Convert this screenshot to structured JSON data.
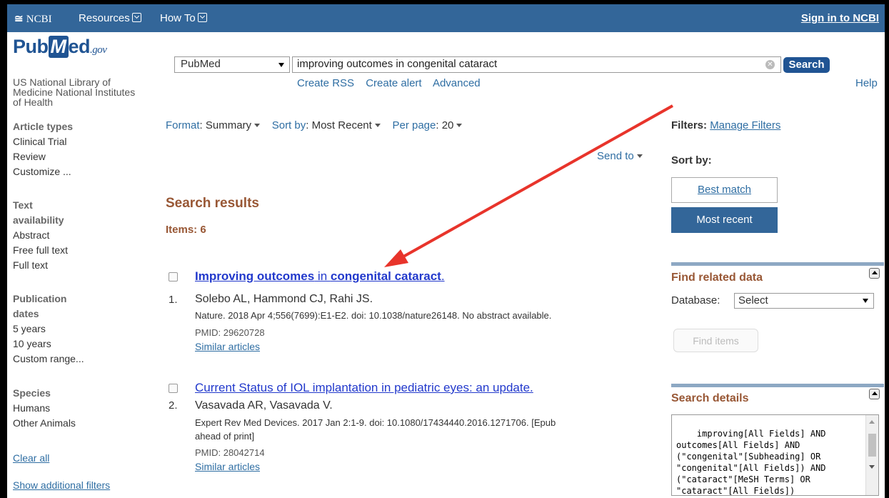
{
  "topbar": {
    "ncbi": "NCBI",
    "resources": "Resources",
    "howto": "How To",
    "signin": "Sign in to NCBI"
  },
  "header": {
    "logo_pub": "Pub",
    "logo_m": "M",
    "logo_ed": "ed",
    "logo_gov": ".gov",
    "logo_sub1": "US National Library of",
    "logo_sub2": "Medicine National Institutes",
    "logo_sub3": "of Health",
    "db_value": "PubMed",
    "search_value": "improving outcomes in congenital cataract",
    "search_button": "Search",
    "links": [
      "Create RSS",
      "Create alert",
      "Advanced"
    ],
    "help": "Help"
  },
  "sidebar": {
    "article_types": {
      "heading": "Article types",
      "items": [
        "Clinical Trial",
        "Review",
        "Customize ..."
      ]
    },
    "text_availability": {
      "heading1": "Text",
      "heading2": "availability",
      "items": [
        "Abstract",
        "Free full text",
        "Full text"
      ]
    },
    "pub_dates": {
      "heading1": "Publication",
      "heading2": "dates",
      "items": [
        "5 years",
        "10 years",
        "Custom range..."
      ]
    },
    "species": {
      "heading": "Species",
      "items": [
        "Humans",
        "Other Animals"
      ]
    },
    "clear_all": "Clear all",
    "show_filters": "Show additional filters"
  },
  "toolbar": {
    "format_label": "Format",
    "format_value": "Summary",
    "sort_label": "Sort by",
    "sort_value": "Most Recent",
    "perpage_label": "Per page",
    "perpage_value": "20",
    "send_to": "Send to"
  },
  "results": {
    "heading": "Search results",
    "items_count": "Items: 6",
    "list": [
      {
        "num": "1.",
        "title_a": "Improving outcomes",
        "title_b": " in ",
        "title_c": "congenital cataract",
        "title_d": ".",
        "authors": "Solebo AL, Hammond CJ, Rahi JS.",
        "citation": "Nature. 2018 Apr 4;556(7699):E1-E2. doi: 10.1038/nature26148. No abstract available.",
        "pmid": "PMID: 29620728",
        "similar": "Similar articles"
      },
      {
        "num": "2.",
        "title": "Current Status of IOL implantation in pediatric eyes: an update.",
        "authors": "Vasavada AR, Vasavada V.",
        "citation1": "Expert Rev Med Devices. 2017 Jan 2:1-9. doi: 10.1080/17434440.2016.1271706. [Epub",
        "citation2": "ahead of print]",
        "pmid": "PMID: 28042714",
        "similar": "Similar articles"
      }
    ]
  },
  "right": {
    "filters_label": "Filters:",
    "manage_filters": "Manage Filters",
    "sort_by": "Sort by:",
    "best_match": "Best match",
    "most_recent": "Most recent",
    "find_related": "Find related data",
    "database_label": "Database:",
    "database_value": "Select",
    "find_items": "Find items",
    "search_details_title": "Search details",
    "search_details_text": "improving[All Fields] AND\noutcomes[All Fields] AND\n(\"congenital\"[Subheading] OR\n\"congenital\"[All Fields]) AND\n(\"cataract\"[MeSH Terms] OR\n\"cataract\"[All Fields])"
  },
  "colors": {
    "ncbi_bar": "#336699",
    "arrow": "#e8342b",
    "link": "#2f6ea3",
    "result_link": "#2239cc",
    "heading_brown": "#985735",
    "selected_sort": "#336699"
  }
}
